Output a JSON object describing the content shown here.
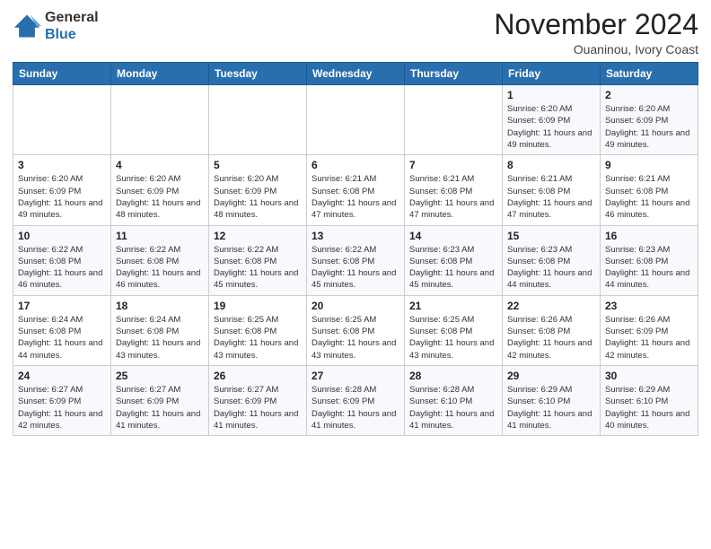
{
  "header": {
    "logo_general": "General",
    "logo_blue": "Blue",
    "month_title": "November 2024",
    "location": "Ouaninou, Ivory Coast"
  },
  "days_of_week": [
    "Sunday",
    "Monday",
    "Tuesday",
    "Wednesday",
    "Thursday",
    "Friday",
    "Saturday"
  ],
  "weeks": [
    [
      {
        "day": "",
        "info": ""
      },
      {
        "day": "",
        "info": ""
      },
      {
        "day": "",
        "info": ""
      },
      {
        "day": "",
        "info": ""
      },
      {
        "day": "",
        "info": ""
      },
      {
        "day": "1",
        "info": "Sunrise: 6:20 AM\nSunset: 6:09 PM\nDaylight: 11 hours and 49 minutes."
      },
      {
        "day": "2",
        "info": "Sunrise: 6:20 AM\nSunset: 6:09 PM\nDaylight: 11 hours and 49 minutes."
      }
    ],
    [
      {
        "day": "3",
        "info": "Sunrise: 6:20 AM\nSunset: 6:09 PM\nDaylight: 11 hours and 49 minutes."
      },
      {
        "day": "4",
        "info": "Sunrise: 6:20 AM\nSunset: 6:09 PM\nDaylight: 11 hours and 48 minutes."
      },
      {
        "day": "5",
        "info": "Sunrise: 6:20 AM\nSunset: 6:09 PM\nDaylight: 11 hours and 48 minutes."
      },
      {
        "day": "6",
        "info": "Sunrise: 6:21 AM\nSunset: 6:08 PM\nDaylight: 11 hours and 47 minutes."
      },
      {
        "day": "7",
        "info": "Sunrise: 6:21 AM\nSunset: 6:08 PM\nDaylight: 11 hours and 47 minutes."
      },
      {
        "day": "8",
        "info": "Sunrise: 6:21 AM\nSunset: 6:08 PM\nDaylight: 11 hours and 47 minutes."
      },
      {
        "day": "9",
        "info": "Sunrise: 6:21 AM\nSunset: 6:08 PM\nDaylight: 11 hours and 46 minutes."
      }
    ],
    [
      {
        "day": "10",
        "info": "Sunrise: 6:22 AM\nSunset: 6:08 PM\nDaylight: 11 hours and 46 minutes."
      },
      {
        "day": "11",
        "info": "Sunrise: 6:22 AM\nSunset: 6:08 PM\nDaylight: 11 hours and 46 minutes."
      },
      {
        "day": "12",
        "info": "Sunrise: 6:22 AM\nSunset: 6:08 PM\nDaylight: 11 hours and 45 minutes."
      },
      {
        "day": "13",
        "info": "Sunrise: 6:22 AM\nSunset: 6:08 PM\nDaylight: 11 hours and 45 minutes."
      },
      {
        "day": "14",
        "info": "Sunrise: 6:23 AM\nSunset: 6:08 PM\nDaylight: 11 hours and 45 minutes."
      },
      {
        "day": "15",
        "info": "Sunrise: 6:23 AM\nSunset: 6:08 PM\nDaylight: 11 hours and 44 minutes."
      },
      {
        "day": "16",
        "info": "Sunrise: 6:23 AM\nSunset: 6:08 PM\nDaylight: 11 hours and 44 minutes."
      }
    ],
    [
      {
        "day": "17",
        "info": "Sunrise: 6:24 AM\nSunset: 6:08 PM\nDaylight: 11 hours and 44 minutes."
      },
      {
        "day": "18",
        "info": "Sunrise: 6:24 AM\nSunset: 6:08 PM\nDaylight: 11 hours and 43 minutes."
      },
      {
        "day": "19",
        "info": "Sunrise: 6:25 AM\nSunset: 6:08 PM\nDaylight: 11 hours and 43 minutes."
      },
      {
        "day": "20",
        "info": "Sunrise: 6:25 AM\nSunset: 6:08 PM\nDaylight: 11 hours and 43 minutes."
      },
      {
        "day": "21",
        "info": "Sunrise: 6:25 AM\nSunset: 6:08 PM\nDaylight: 11 hours and 43 minutes."
      },
      {
        "day": "22",
        "info": "Sunrise: 6:26 AM\nSunset: 6:08 PM\nDaylight: 11 hours and 42 minutes."
      },
      {
        "day": "23",
        "info": "Sunrise: 6:26 AM\nSunset: 6:09 PM\nDaylight: 11 hours and 42 minutes."
      }
    ],
    [
      {
        "day": "24",
        "info": "Sunrise: 6:27 AM\nSunset: 6:09 PM\nDaylight: 11 hours and 42 minutes."
      },
      {
        "day": "25",
        "info": "Sunrise: 6:27 AM\nSunset: 6:09 PM\nDaylight: 11 hours and 41 minutes."
      },
      {
        "day": "26",
        "info": "Sunrise: 6:27 AM\nSunset: 6:09 PM\nDaylight: 11 hours and 41 minutes."
      },
      {
        "day": "27",
        "info": "Sunrise: 6:28 AM\nSunset: 6:09 PM\nDaylight: 11 hours and 41 minutes."
      },
      {
        "day": "28",
        "info": "Sunrise: 6:28 AM\nSunset: 6:10 PM\nDaylight: 11 hours and 41 minutes."
      },
      {
        "day": "29",
        "info": "Sunrise: 6:29 AM\nSunset: 6:10 PM\nDaylight: 11 hours and 41 minutes."
      },
      {
        "day": "30",
        "info": "Sunrise: 6:29 AM\nSunset: 6:10 PM\nDaylight: 11 hours and 40 minutes."
      }
    ]
  ]
}
